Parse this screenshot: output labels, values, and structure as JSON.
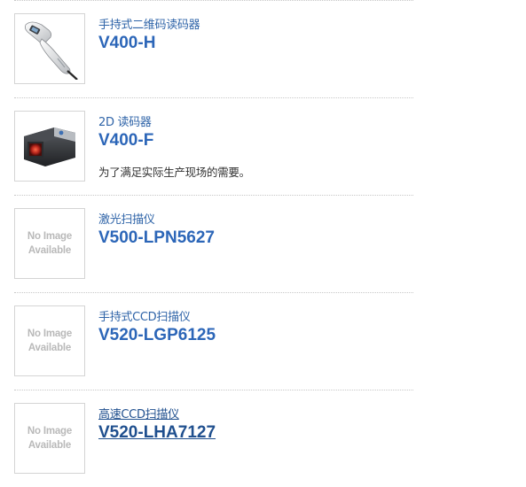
{
  "products": [
    {
      "category": "手持式二维码读码器",
      "model": "V400-H",
      "description": "",
      "image": "handheld-scanner-photo"
    },
    {
      "category": "2D 读码器",
      "model": "V400-F",
      "description": "为了满足实际生产现场的需要。",
      "image": "fixed-reader-photo"
    },
    {
      "category": "激光扫描仪",
      "model": "V500-LPN5627",
      "description": "",
      "image": "no-image"
    },
    {
      "category": "手持式CCD扫描仪",
      "model": "V520-LGP6125",
      "description": "",
      "image": "no-image"
    },
    {
      "category": "高速CCD扫描仪",
      "model": "V520-LHA7127",
      "description": "",
      "image": "no-image"
    }
  ],
  "placeholder": {
    "line1": "No Image",
    "line2": "Available"
  },
  "colors": {
    "link": "#2c66b8",
    "category": "#2f64a8",
    "hover": "#1f4f8e",
    "placeholder_text": "#b9b9b9"
  }
}
